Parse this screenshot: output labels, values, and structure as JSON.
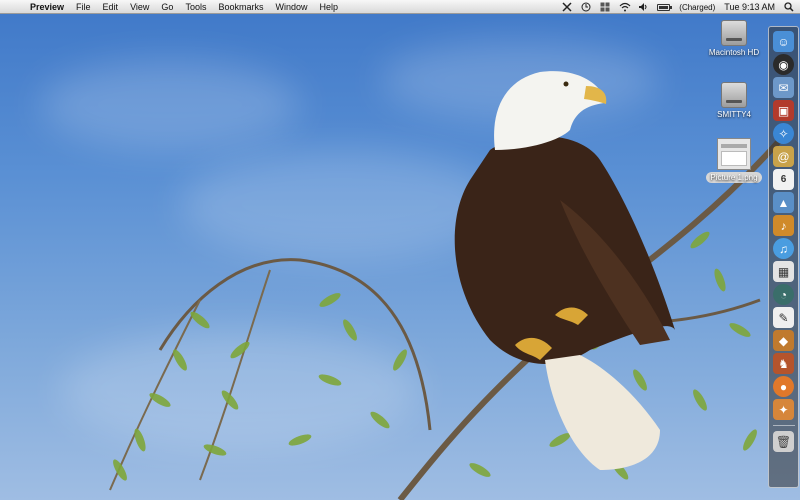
{
  "menubar": {
    "apple_glyph": "",
    "app_name": "Preview",
    "items": [
      "File",
      "Edit",
      "View",
      "Go",
      "Tools",
      "Bookmarks",
      "Window",
      "Help"
    ],
    "battery_status": "(Charged)",
    "clock": "Tue 9:13 AM",
    "status_icons": [
      "tools-icon",
      "time-machine-icon",
      "spaces-icon",
      "wifi-icon",
      "volume-icon",
      "battery-icon",
      "spotlight-icon"
    ]
  },
  "desktop": {
    "icons": [
      {
        "label": "Macintosh HD",
        "icon": "hard-drive-icon"
      },
      {
        "label": "SMITTY4",
        "icon": "hard-drive-icon"
      },
      {
        "label": "Picture 1.png",
        "icon": "image-file-icon"
      }
    ]
  },
  "dock": {
    "items": [
      {
        "name": "finder-icon",
        "color": "#4a8fd6"
      },
      {
        "name": "dashboard-icon",
        "color": "#2b2b2b"
      },
      {
        "name": "mail-icon",
        "color": "#6d98c9"
      },
      {
        "name": "photo-booth-icon",
        "color": "#b23a2c"
      },
      {
        "name": "safari-icon",
        "color": "#3a86d4"
      },
      {
        "name": "address-book-icon",
        "color": "#c8a24a"
      },
      {
        "name": "ical-icon",
        "color": "#f2f2f2"
      },
      {
        "name": "iphoto-icon",
        "color": "#5a8fc7"
      },
      {
        "name": "garageband-icon",
        "color": "#d08a2a"
      },
      {
        "name": "itunes-icon",
        "color": "#4a9de0"
      },
      {
        "name": "preview-icon",
        "color": "#e3e3e3"
      },
      {
        "name": "time-machine-icon",
        "color": "#3a6e6a"
      },
      {
        "name": "textedit-icon",
        "color": "#efefef"
      },
      {
        "name": "app-store-icon",
        "color": "#c07a2e"
      },
      {
        "name": "game-icon",
        "color": "#b5542c"
      },
      {
        "name": "firefox-icon",
        "color": "#e1782a"
      },
      {
        "name": "image-editor-icon",
        "color": "#d6863a"
      }
    ],
    "trash": {
      "name": "trash-icon",
      "color": "#cfcfcf"
    }
  }
}
